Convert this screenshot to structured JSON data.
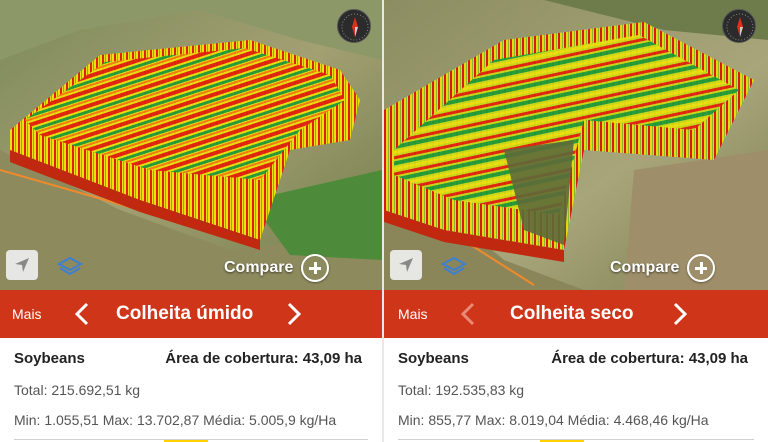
{
  "panels": [
    {
      "mais_label": "Mais",
      "title": "Colheita úmido",
      "compare_label": "Compare",
      "crop": "Soybeans",
      "area_label": "Área de cobertura: 43,09 ha",
      "total": "Total: 215.692,51 kg",
      "stats": "Min: 1.055,51 Max: 13.702,87 Média: 5.005,9 kg/Ha"
    },
    {
      "mais_label": "Mais",
      "title": "Colheita seco",
      "compare_label": "Compare",
      "crop": "Soybeans",
      "area_label": "Área de cobertura: 43,09 ha",
      "total": "Total: 192.535,83 kg",
      "stats": "Min: 855,77 Max: 8.019,04 Média: 4.468,46 kg/Ha"
    }
  ],
  "colors": {
    "bar": "#cf3518",
    "yield_high": "#1f9a3a",
    "yield_mid": "#e8e010",
    "yield_low": "#e02010",
    "field_boundary": "#f08a2a"
  },
  "icons": [
    "compass-icon",
    "location-arrow-icon",
    "layers-icon",
    "chevron-left-icon",
    "chevron-right-icon",
    "plus-circle-icon"
  ]
}
